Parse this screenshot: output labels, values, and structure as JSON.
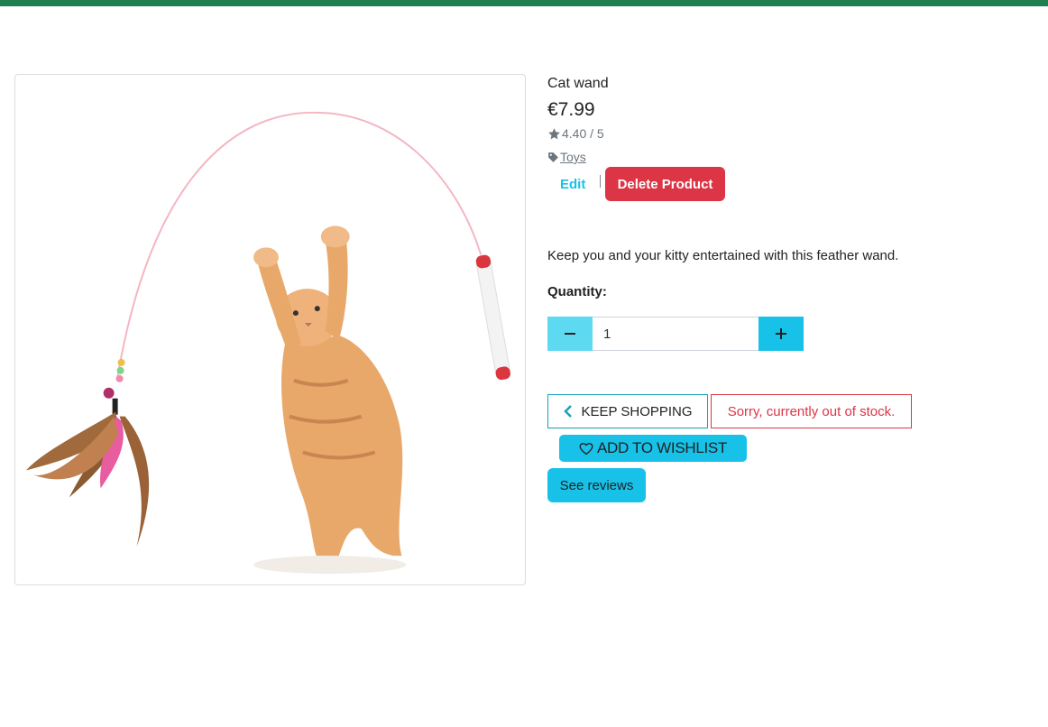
{
  "product": {
    "name": "Cat wand",
    "price": "€7.99",
    "rating": "4.40 / 5",
    "category": "Toys",
    "description": "Keep you and your kitty entertained with this feather wand.",
    "image_alt": "Kitten playing with feather cat wand"
  },
  "admin": {
    "edit_label": "Edit",
    "delete_label": "Delete Product"
  },
  "quantity": {
    "label": "Quantity:",
    "value": "1"
  },
  "actions": {
    "keep_shopping_label": "KEEP SHOPPING",
    "out_of_stock_text": "Sorry, currently out of stock.",
    "wishlist_label": "ADD TO WISHLIST",
    "reviews_label": "See reviews"
  },
  "icons": {
    "rating": "star-icon",
    "category": "tag-icon",
    "decrement": "minus-icon",
    "increment": "plus-icon",
    "back": "chevron-left-icon",
    "wishlist": "heart-icon"
  },
  "colors": {
    "top_bar": "#1e7e4e",
    "accent": "#17c1e8",
    "danger": "#dc3545",
    "muted": "#6c757d"
  }
}
